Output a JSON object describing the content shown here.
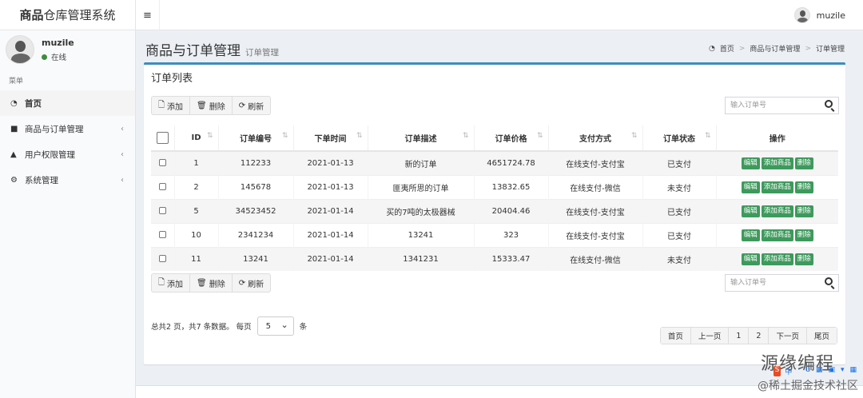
{
  "app": {
    "brand_bold": "商品",
    "brand_rest": "仓库管理系统"
  },
  "topbar": {
    "toggle_icon": "menu-icon",
    "username": "muzile"
  },
  "sidebar": {
    "username": "muzile",
    "status": "在线",
    "menu_header": "菜单",
    "items": [
      {
        "label": "首页",
        "icon": "dashboard-icon"
      },
      {
        "label": "商品与订单管理",
        "icon": "folder-icon"
      },
      {
        "label": "用户权限管理",
        "icon": "lock-icon"
      },
      {
        "label": "系统管理",
        "icon": "gears-icon"
      }
    ]
  },
  "page": {
    "title": "商品与订单管理",
    "subtitle": "订单管理"
  },
  "breadcrumb": [
    "首页",
    "商品与订单管理",
    "订单管理"
  ],
  "box": {
    "title": "订单列表"
  },
  "toolbar": {
    "add": "添加",
    "delete": "删除",
    "refresh": "刷新"
  },
  "search": {
    "placeholder": "输入订单号"
  },
  "table": {
    "columns": [
      "ID",
      "订单编号",
      "下单时间",
      "订单描述",
      "订单价格",
      "支付方式",
      "订单状态",
      "操作"
    ],
    "rows": [
      {
        "id": "1",
        "no": "112233",
        "time": "2021-01-13",
        "desc": "新的订单",
        "price": "4651724.78",
        "pay": "在线支付-支付宝",
        "status": "已支付"
      },
      {
        "id": "2",
        "no": "145678",
        "time": "2021-01-13",
        "desc": "匪夷所思的订单",
        "price": "13832.65",
        "pay": "在线支付-微信",
        "status": "未支付"
      },
      {
        "id": "5",
        "no": "34523452",
        "time": "2021-01-14",
        "desc": "买的7吨的太极器械",
        "price": "20404.46",
        "pay": "在线支付-支付宝",
        "status": "已支付"
      },
      {
        "id": "10",
        "no": "2341234",
        "time": "2021-01-14",
        "desc": "13241",
        "price": "323",
        "pay": "在线支付-支付宝",
        "status": "已支付"
      },
      {
        "id": "11",
        "no": "13241",
        "time": "2021-01-14",
        "desc": "1341231",
        "price": "15333.47",
        "pay": "在线支付-微信",
        "status": "未支付"
      }
    ],
    "actions": {
      "edit": "编辑",
      "add_goods": "添加商品",
      "delete": "删除"
    }
  },
  "pagination": {
    "info": "总共2 页，共7 条数据。 每页",
    "page_size": "5",
    "unit": "条",
    "buttons": [
      "首页",
      "上一页",
      "1",
      "2",
      "下一页",
      "尾页"
    ]
  },
  "watermark": {
    "line1": "源缘编程",
    "line2": "@稀土掘金技术社区",
    "bar": [
      "S",
      "中",
      "·",
      "ǔ",
      "▦",
      "▣",
      "▾",
      "▦"
    ]
  }
}
